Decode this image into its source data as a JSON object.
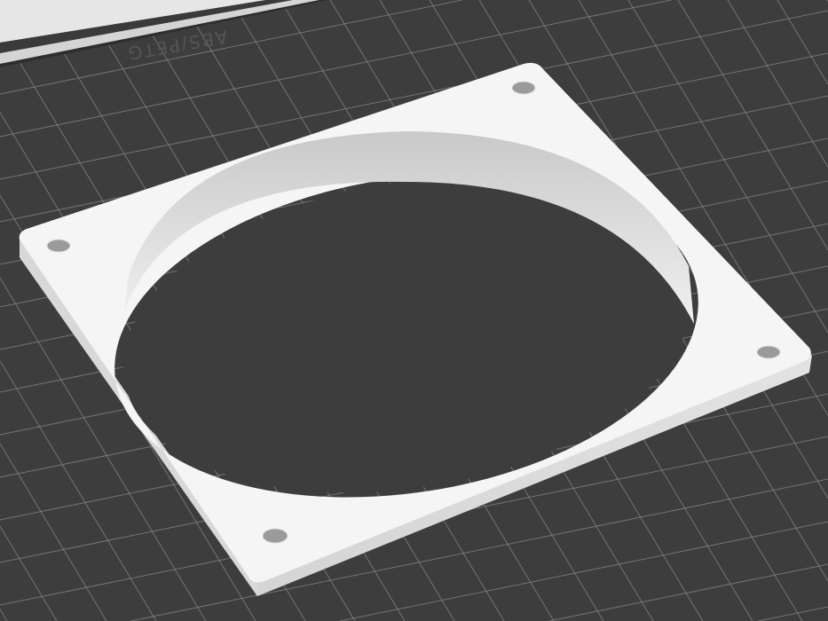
{
  "bed": {
    "label": "ABS/PETG",
    "bed_color": "#3c3d3c",
    "grid_color": "#8a8b8a"
  },
  "model": {
    "name": "fan-adapter-plate",
    "color": "#f4f4f4"
  }
}
